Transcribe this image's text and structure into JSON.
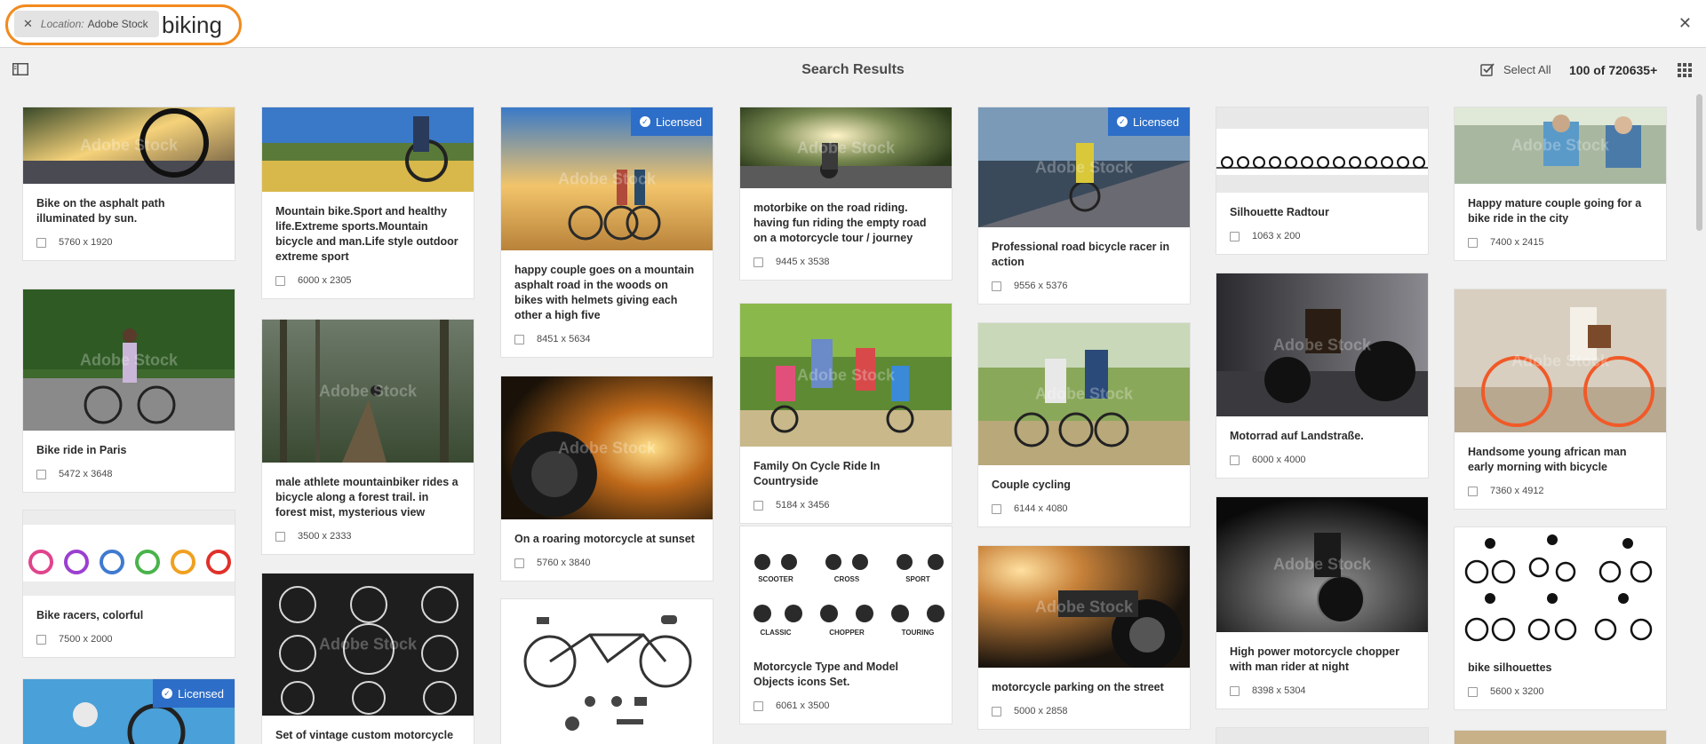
{
  "search": {
    "location_label": "Location:",
    "location_value": "Adobe Stock",
    "query": "biking",
    "clear_icon": "close-icon"
  },
  "toolbar": {
    "title": "Search Results",
    "select_all_label": "Select All",
    "result_count": "100 of 720635+"
  },
  "watermark": "Adobe Stock",
  "badge_label": "Licensed",
  "cards": [
    {
      "title": "Bike on the asphalt path illuminated by sun.",
      "size": "5760 x 1920",
      "licensed": false
    },
    {
      "title": "Bike ride in Paris",
      "size": "5472 x 3648",
      "licensed": false
    },
    {
      "title": "Bike racers, colorful",
      "size": "7500 x 2000",
      "licensed": false
    },
    {
      "title": "",
      "size": "",
      "licensed": true
    },
    {
      "title": "Mountain bike.Sport and healthy life.Extreme sports.Mountain bicycle and man.Life style outdoor extreme sport",
      "size": "6000 x 2305",
      "licensed": false
    },
    {
      "title": "male athlete mountainbiker rides a bicycle along a forest trail. in forest mist, mysterious view",
      "size": "3500 x 2333",
      "licensed": false
    },
    {
      "title": "Set of vintage custom motorcycle",
      "size": "",
      "licensed": false
    },
    {
      "title": "happy couple goes on a mountain asphalt road in the woods on bikes with helmets giving each other a high five",
      "size": "8451 x 5634",
      "licensed": true
    },
    {
      "title": "On a roaring motorcycle at sunset",
      "size": "5760 x 3840",
      "licensed": false
    },
    {
      "title": "",
      "size": "",
      "licensed": false
    },
    {
      "title": "motorbike on the road riding. having fun riding the empty road on a motorcycle tour / journey",
      "size": "9445 x 3538",
      "licensed": false
    },
    {
      "title": "Family On Cycle Ride In Countryside",
      "size": "5184 x 3456",
      "licensed": false
    },
    {
      "title": "Motorcycle Type and Model Objects icons Set.",
      "size": "6061 x 3500",
      "licensed": false
    },
    {
      "title": "Professional road bicycle racer in action",
      "size": "9556 x 5376",
      "licensed": true
    },
    {
      "title": "Couple cycling",
      "size": "6144 x 4080",
      "licensed": false
    },
    {
      "title": "motorcycle parking on the street",
      "size": "5000 x 2858",
      "licensed": false
    },
    {
      "title": "Silhouette Radtour",
      "size": "1063 x 200",
      "licensed": false
    },
    {
      "title": "Motorrad auf Landstraße.",
      "size": "6000 x 4000",
      "licensed": false
    },
    {
      "title": "High power motorcycle chopper with man rider at night",
      "size": "8398 x 5304",
      "licensed": false
    },
    {
      "title": "",
      "size": "",
      "licensed": false
    },
    {
      "title": "Happy mature couple going for a bike ride in the city",
      "size": "7400 x 2415",
      "licensed": false
    },
    {
      "title": "Handsome young african man early morning with bicycle",
      "size": "7360 x 4912",
      "licensed": false
    },
    {
      "title": "bike silhouettes",
      "size": "5600 x 3200",
      "licensed": false
    },
    {
      "title": "",
      "size": "",
      "licensed": false
    }
  ],
  "moto_icon_labels": [
    "SCOOTER",
    "CROSS",
    "SPORT",
    "CLASSIC",
    "CHOPPER",
    "TOURING"
  ]
}
